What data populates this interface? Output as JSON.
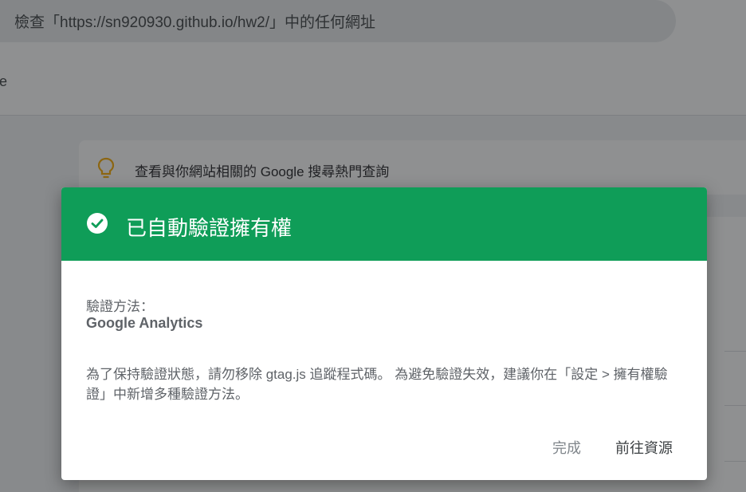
{
  "search": {
    "text": "檢查「https://sn920930.github.io/hw2/」中的任何網址"
  },
  "header": {
    "fragment": "се"
  },
  "tip": {
    "icon": "lightbulb-icon",
    "text": "查看與你網站相關的 Google 搜尋熱門查詢"
  },
  "dialog": {
    "header_color": "#0f9d58",
    "icon": "check-circle-icon",
    "title": "已自動驗證擁有權",
    "method_label": "驗證方法：",
    "method_value": "Google Analytics",
    "notice": "為了保持驗證狀態，請勿移除 gtag.js 追蹤程式碼。 為避免驗證失效，建議你在「設定 > 擁有權驗證」中新增多種驗證方法。",
    "buttons": {
      "done": "完成",
      "go_to_property": "前往資源"
    }
  }
}
